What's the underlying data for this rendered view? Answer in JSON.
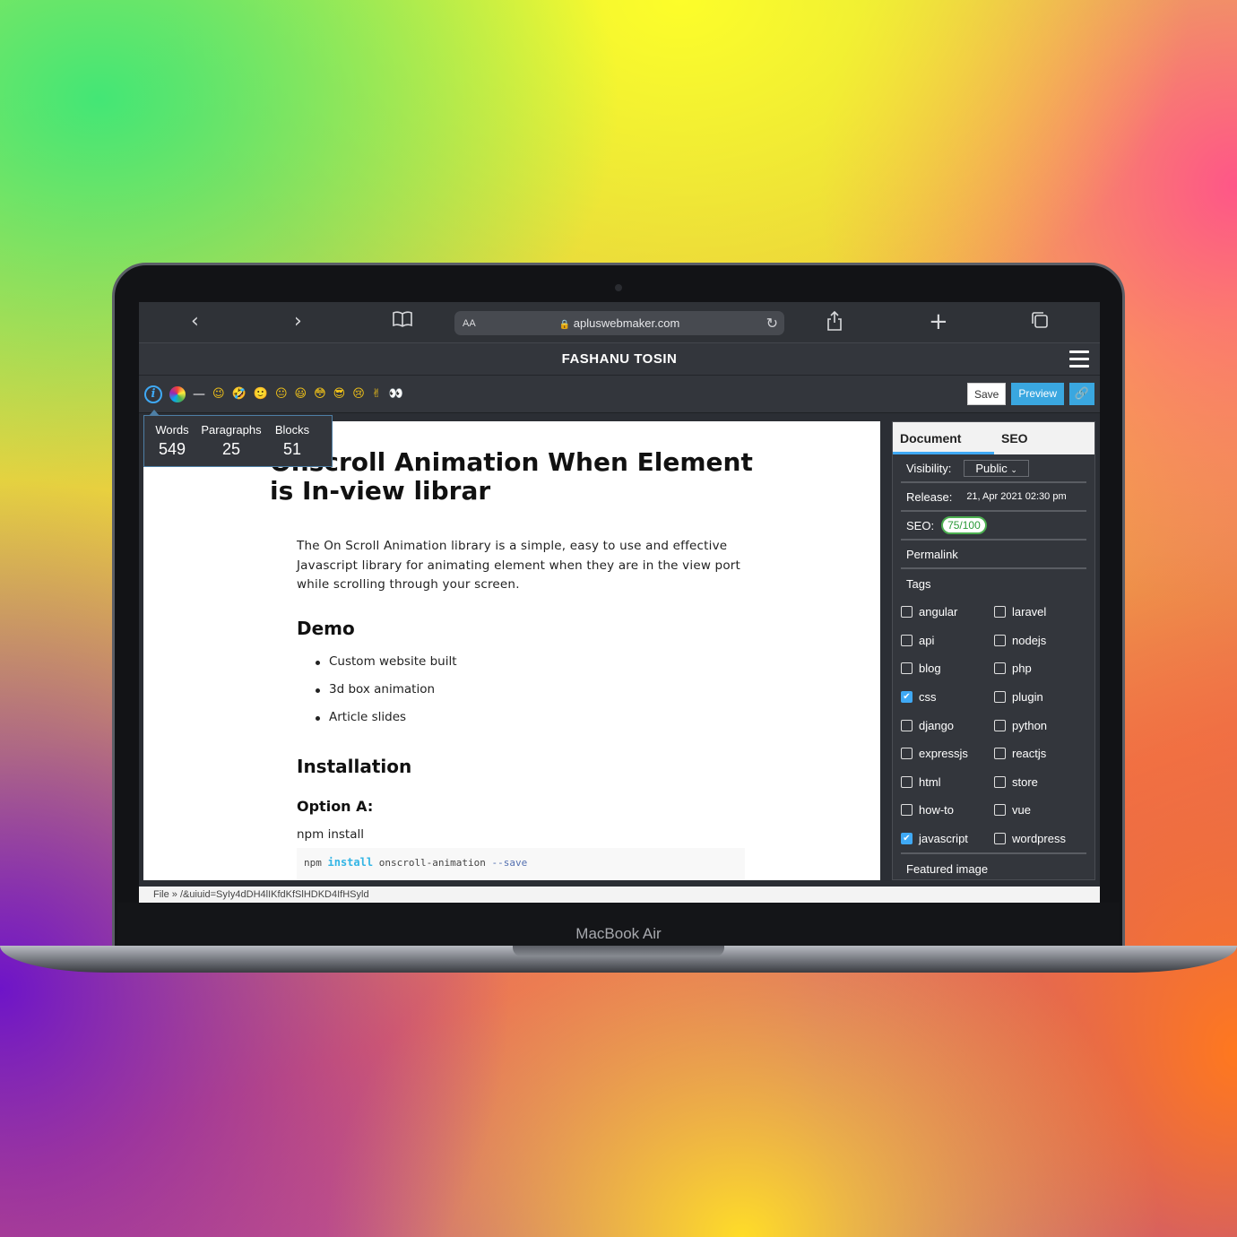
{
  "device": {
    "brand": "MacBook Air"
  },
  "browser": {
    "url": "apluswebmaker.com",
    "text_size_label": "AA",
    "icons": [
      "back-icon",
      "forward-icon",
      "bookmarks-icon",
      "lock-icon",
      "reload-icon",
      "share-icon",
      "new-tab-icon",
      "tabs-icon"
    ]
  },
  "header": {
    "title": "FASHANU TOSIN"
  },
  "toolbar": {
    "emojis": [
      "😉",
      "🤣",
      "🙂",
      "😐",
      "😃",
      "😳",
      "😎",
      "😢",
      "✌",
      "👀"
    ],
    "save_label": "Save",
    "preview_label": "Preview",
    "link_icon": "🔗"
  },
  "stats": {
    "words_label": "Words",
    "words": "549",
    "paragraphs_label": "Paragraphs",
    "paragraphs": "25",
    "blocks_label": "Blocks",
    "blocks": "51"
  },
  "document": {
    "title": "Onscroll Animation When Element is In-view librar",
    "intro": "The On Scroll Animation library is a simple, easy to use and effective Javascript library for animating element when they are in the view port while scrolling through your screen.",
    "demo_heading": "Demo",
    "demo_items": [
      "Custom website built",
      "3d box animation",
      "Article slides"
    ],
    "install_heading": "Installation",
    "option_heading": "Option A:",
    "npm_text": "npm install",
    "code_cmd": "npm",
    "code_kw": "install",
    "code_pkg": "onscroll-animation",
    "code_flag": "--save"
  },
  "sidebar": {
    "tab_document": "Document",
    "tab_seo": "SEO",
    "visibility_label": "Visibility:",
    "visibility_value": "Public",
    "release_label": "Release:",
    "release_value": "21, Apr 2021 02:30 pm",
    "seo_label": "SEO:",
    "seo_value": "75/100",
    "permalink_label": "Permalink",
    "tags_label": "Tags",
    "tags": [
      {
        "name": "angular",
        "checked": false
      },
      {
        "name": "laravel",
        "checked": false
      },
      {
        "name": "api",
        "checked": false
      },
      {
        "name": "nodejs",
        "checked": false
      },
      {
        "name": "blog",
        "checked": false
      },
      {
        "name": "php",
        "checked": false
      },
      {
        "name": "css",
        "checked": true
      },
      {
        "name": "plugin",
        "checked": false
      },
      {
        "name": "django",
        "checked": false
      },
      {
        "name": "python",
        "checked": false
      },
      {
        "name": "expressjs",
        "checked": false
      },
      {
        "name": "reactjs",
        "checked": false
      },
      {
        "name": "html",
        "checked": false
      },
      {
        "name": "store",
        "checked": false
      },
      {
        "name": "how-to",
        "checked": false
      },
      {
        "name": "vue",
        "checked": false
      },
      {
        "name": "javascript",
        "checked": true
      },
      {
        "name": "wordpress",
        "checked": false
      }
    ],
    "featured_label": "Featured image"
  },
  "statusbar": {
    "path": "File » /&uiuid=SyIy4dDH4lIKfdKfSlHDKD4IfHSyld"
  },
  "colors": {
    "accent": "#3fa9f5",
    "seo_green": "#4caf50",
    "panel": "#33363c"
  }
}
